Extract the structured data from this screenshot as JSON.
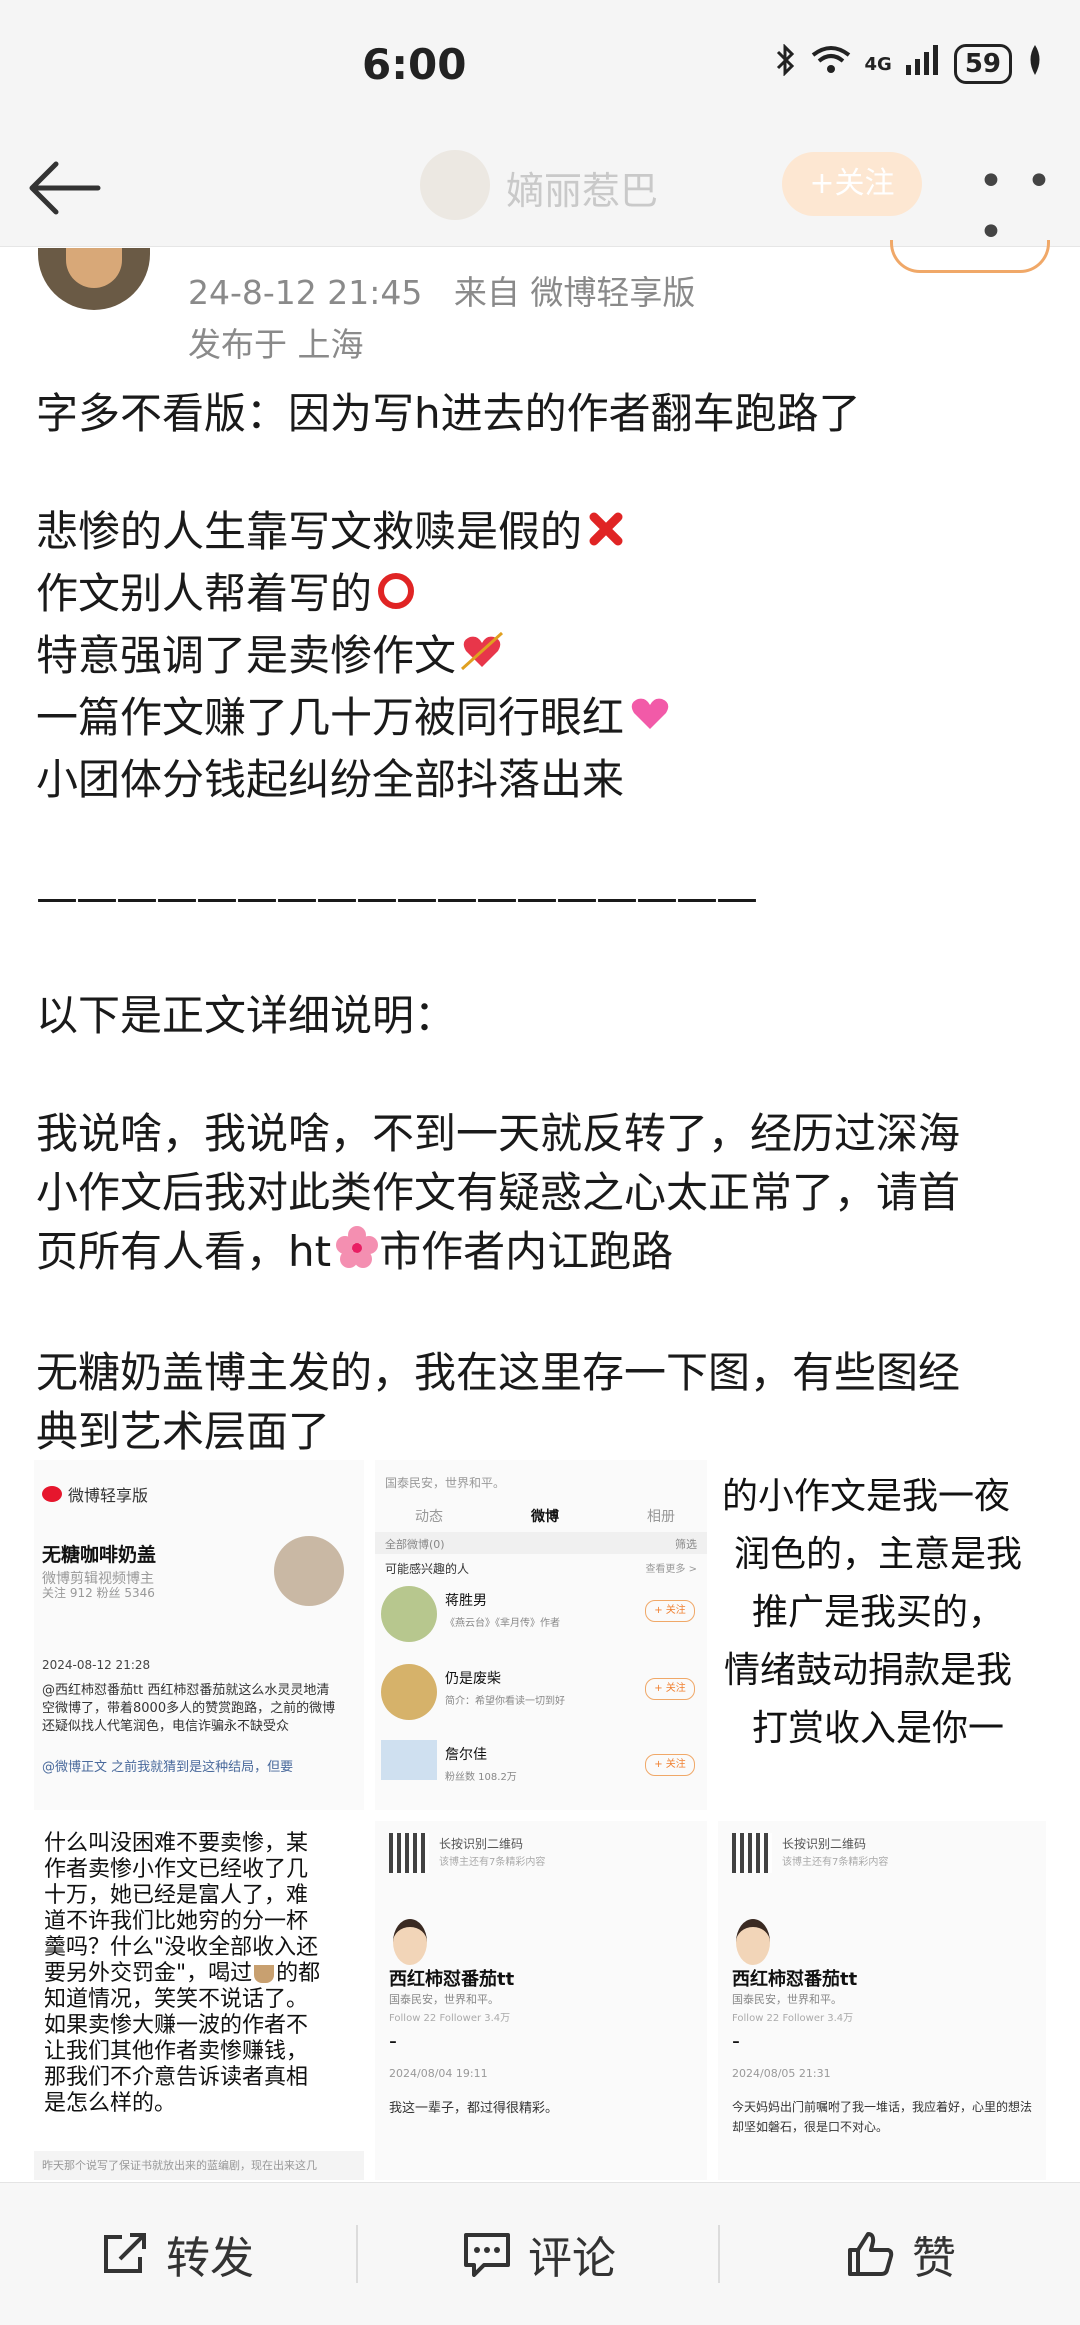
{
  "status_bar": {
    "time": "6:00",
    "network": "4G",
    "battery": "59"
  },
  "nav": {
    "title": "嫡丽惹巴",
    "follow": "+关注",
    "more": "• • •"
  },
  "post": {
    "timestamp": "24-8-12 21:45",
    "source": "来自 微博轻享版",
    "location": "发布于 上海",
    "lines": {
      "l1": "字多不看版：因为写h进去的作者翻车跑路了",
      "l2": "悲惨的人生靠写文救赎是假的",
      "l3": "作文别人帮着写的",
      "l4": "特意强调了是卖惨作文",
      "l5": "一篇作文赚了几十万被同行眼红",
      "l6": "小团体分钱起纠纷全部抖落出来",
      "l7": "——————————————————",
      "l8": "以下是正文详细说明：",
      "l9a": "我说啥，我说啥，不到一天就反转了，经历过深海",
      "l9b": "小作文后我对此类作文有疑惑之心太正常了，请首",
      "l9c": "页所有人看，ht",
      "l9d": "市作者内讧跑路",
      "l10a": "无糖奶盖博主发的，我在这里存一下图，有些图经",
      "l10b": "典到艺术层面了"
    }
  },
  "images": {
    "p1": {
      "app": "微博轻享版",
      "name": "无糖咖啡奶盖",
      "desc": "微博剪辑视频博主",
      "stats": "关注 912    粉丝 5346",
      "date": "2024-08-12 21:28",
      "text": "@西红柿怼番茄tt 西红柿怼番茄就这么水灵灵地清空微博了，带着8000多人的赞赏跑路，之前的微博还疑似找人代笔润色，电信诈骗永不缺受众",
      "text2": "@微博正文 之前我就猜到是这种结局，但要"
    },
    "p2": {
      "header": "国泰民安，世界和平。",
      "tabs": [
        "动态",
        "微博",
        "相册"
      ],
      "filter": "全部微博(0)",
      "filter_right": "筛选",
      "rec_title": "可能感兴趣的人",
      "rec_more": "查看更多 >",
      "users": [
        {
          "name": "蒋胜男",
          "desc": "《燕云台》《芈月传》作者",
          "btn": "+ 关注"
        },
        {
          "name": "仍是废柴",
          "desc": "简介：希望你看读一切到好",
          "btn": "+ 关注"
        },
        {
          "name": "詹尔佳",
          "desc": "粉丝数 108.2万",
          "btn": "+ 关注"
        }
      ]
    },
    "p3": {
      "lines": [
        "的小作文是我一夜",
        "润色的，主意是我",
        "推广是我买的，",
        "情绪鼓动捐款是我",
        "打赏收入是你一"
      ]
    },
    "p4": {
      "lines": [
        "什么叫没困难不要卖惨，某",
        "作者卖惨小作文已经收了几",
        "十万，她已经是富人了，难",
        "道不许我们比她穷的分一杯",
        "羹吗？什么\"没收全部收入还",
        "要另外交罚金\"，喝过",
        "的都",
        "知道情况，笑笑不说话了。",
        "如果卖惨大赚一波的作者不",
        "让我们其他作者卖惨赚钱，",
        "那我们不介意告诉读者真相",
        "是怎么样的。"
      ],
      "footer": "昨天那个说写了保证书就放出来的蓝编剧，现在出来这几"
    },
    "p5": {
      "qr": "长按识别二维码",
      "qr_sub": "该博主还有7条精彩内容",
      "name": "西红柿怼番茄tt",
      "bio": "国泰民安，世界和平。",
      "stats": "Follow 22    Follower 3.4万",
      "dash": "-",
      "date": "2024/08/04 19:11",
      "text": "我这一辈子，都过得很精彩。"
    },
    "p6": {
      "qr": "长按识别二维码",
      "qr_sub": "该博主还有7条精彩内容",
      "name": "西红柿怼番茄tt",
      "bio": "国泰民安，世界和平。",
      "stats": "Follow 22    Follower 3.4万",
      "dash": "-",
      "date": "2024/08/05 21:31",
      "text": "今天妈妈出门前嘱咐了我一堆话，我应着好，心里的想法却坚如磐石，很是口不对心。"
    }
  },
  "actions": {
    "repost": "转发",
    "comment": "评论",
    "like": "赞"
  },
  "colors": {
    "accent": "#ff8200",
    "follow_bg": "#fde7d2",
    "meta": "#8a8a8a"
  }
}
